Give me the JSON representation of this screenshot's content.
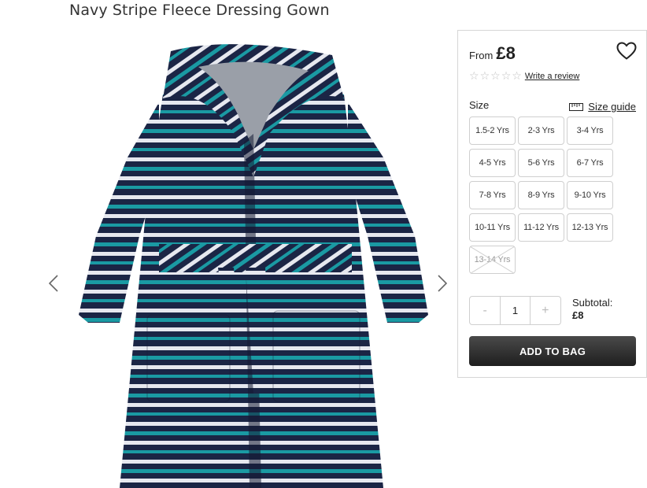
{
  "product": {
    "title": "Navy Stripe Fleece Dressing Gown"
  },
  "gallery": {
    "prev_icon": "chevron-left-icon",
    "next_icon": "chevron-right-icon"
  },
  "price": {
    "from_label": "From",
    "value": "£8"
  },
  "rating": {
    "stars_filled": 0,
    "stars_total": 5,
    "write_review_label": "Write a review"
  },
  "size": {
    "label": "Size",
    "guide_label": "Size guide",
    "options": [
      {
        "label": "1.5-2 Yrs",
        "available": true
      },
      {
        "label": "2-3 Yrs",
        "available": true
      },
      {
        "label": "3-4 Yrs",
        "available": true
      },
      {
        "label": "4-5 Yrs",
        "available": true
      },
      {
        "label": "5-6 Yrs",
        "available": true
      },
      {
        "label": "6-7 Yrs",
        "available": true
      },
      {
        "label": "7-8 Yrs",
        "available": true
      },
      {
        "label": "8-9 Yrs",
        "available": true
      },
      {
        "label": "9-10 Yrs",
        "available": true
      },
      {
        "label": "10-11 Yrs",
        "available": true
      },
      {
        "label": "11-12 Yrs",
        "available": true
      },
      {
        "label": "12-13 Yrs",
        "available": true
      },
      {
        "label": "13-14 Yrs",
        "available": false
      }
    ]
  },
  "quantity": {
    "minus": "-",
    "value": "1",
    "plus": "+"
  },
  "subtotal": {
    "label": "Subtotal:",
    "value": "£8"
  },
  "cta": {
    "add_to_bag": "ADD TO BAG"
  },
  "colors": {
    "navy": "#1b2545",
    "teal": "#1a9aa3",
    "white_stripe": "#e6e8ef",
    "button_dark": "#2a2a2a"
  }
}
